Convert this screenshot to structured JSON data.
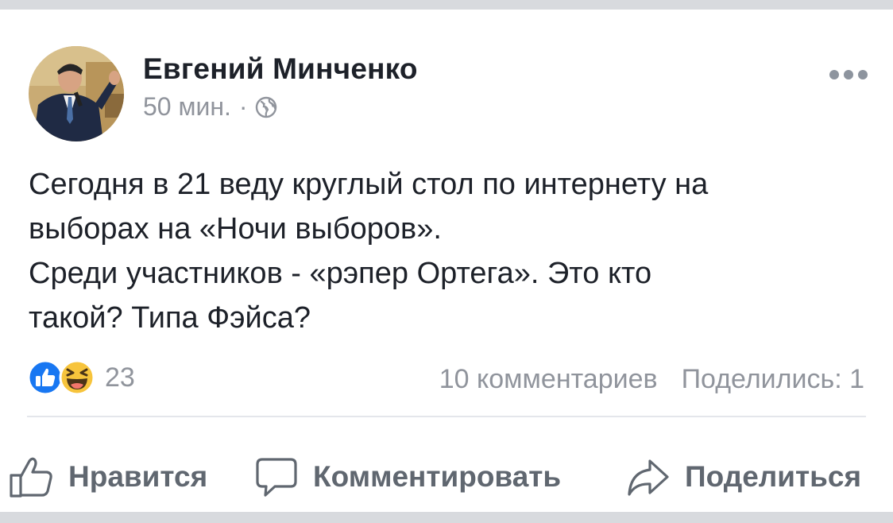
{
  "post": {
    "author": "Евгений Минченко",
    "time": "50 мин.",
    "separator": "·",
    "privacy_icon": "globe-icon",
    "lines": [
      "Сегодня в 21 веду круглый стол по интернету на",
      "выборах на «Ночи выборов».",
      "Среди участников - «рэпер Ортега». Это кто",
      "такой? Типа Фэйса?"
    ]
  },
  "reactions": {
    "icons": [
      "like-reaction-icon",
      "haha-reaction-icon"
    ],
    "count": "23",
    "comments": "10 комментариев",
    "shares": "Поделились: 1"
  },
  "actions": {
    "like": "Нравится",
    "comment": "Комментировать",
    "share": "Поделиться"
  },
  "colors": {
    "like_blue": "#1877f2",
    "haha_yellow": "#f7c43c",
    "muted_text": "#90949c",
    "action_text": "#606770",
    "page_bg": "#d8dade"
  }
}
